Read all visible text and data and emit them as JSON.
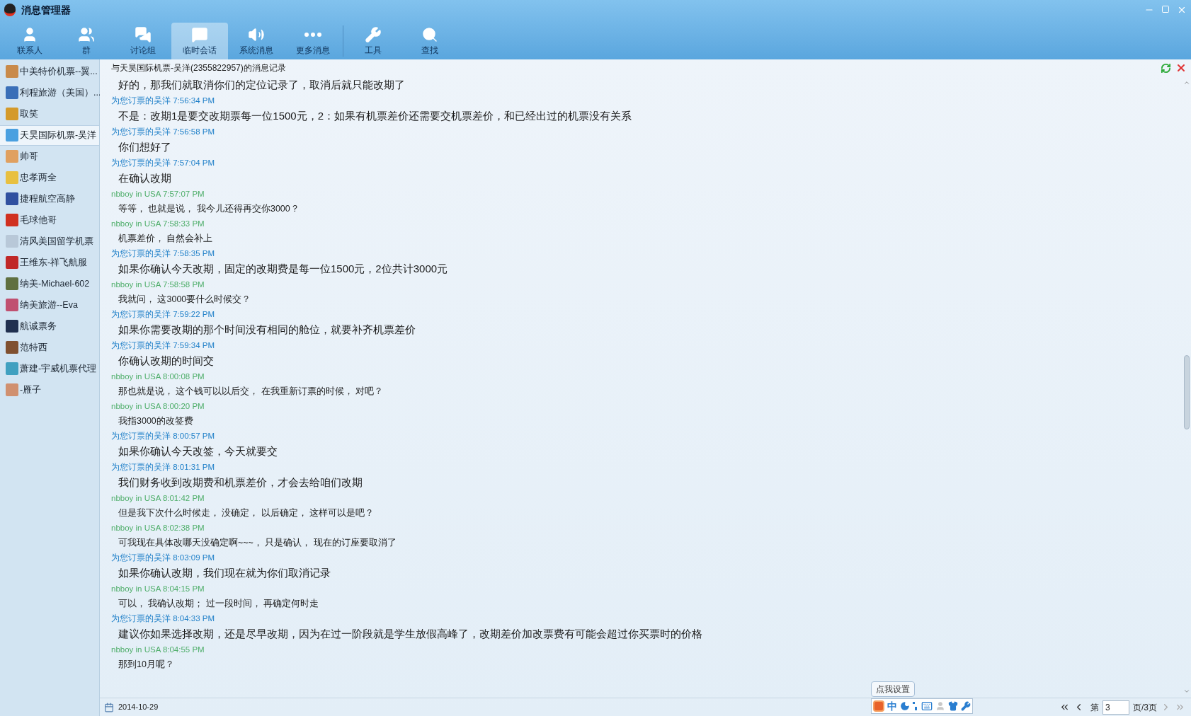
{
  "window": {
    "title": "消息管理器"
  },
  "tabs": [
    {
      "label": "联系人",
      "kind": "user",
      "selected": false
    },
    {
      "label": "群",
      "kind": "group",
      "selected": false
    },
    {
      "label": "讨论组",
      "kind": "discuss",
      "selected": false
    },
    {
      "label": "临时会话",
      "kind": "temp",
      "selected": true
    },
    {
      "label": "系统消息",
      "kind": "speaker",
      "selected": false
    },
    {
      "label": "更多消息",
      "kind": "more",
      "selected": false
    },
    {
      "label": "工具",
      "kind": "wrench",
      "selected": false
    },
    {
      "label": "查找",
      "kind": "search",
      "selected": false
    }
  ],
  "contacts": [
    {
      "name": "中美特价机票--翼...",
      "selected": false
    },
    {
      "name": "利程旅游（美国）...",
      "selected": false
    },
    {
      "name": "取笑",
      "selected": false
    },
    {
      "name": "天昊国际机票-吴洋",
      "selected": true
    },
    {
      "name": "帅哥",
      "selected": false
    },
    {
      "name": "忠孝两全",
      "selected": false
    },
    {
      "name": "捷程航空高静",
      "selected": false
    },
    {
      "name": "毛球他哥",
      "selected": false
    },
    {
      "name": "清风美国留学机票",
      "selected": false
    },
    {
      "name": "王维东-祥飞航服",
      "selected": false
    },
    {
      "name": "纳美-Michael-602",
      "selected": false
    },
    {
      "name": "纳美旅游--Eva",
      "selected": false
    },
    {
      "name": "航诚票务",
      "selected": false
    },
    {
      "name": "范特西",
      "selected": false
    },
    {
      "name": "萧建-宇威机票代理",
      "selected": false
    },
    {
      "name": "-雁子",
      "selected": false
    }
  ],
  "conversation": {
    "title": "与天昊国际机票-吴洋(2355822957)的消息记录",
    "messages": [
      {
        "kind": "agent",
        "text": "好的，那我们就取消你们的定位记录了，取消后就只能改期了"
      },
      {
        "kind": "agent",
        "header": "为您订票的吴洋 7:56:34 PM",
        "text": "不是：改期1是要交改期票每一位1500元，2：如果有机票差价还需要交机票差价，和已经出过的机票没有关系"
      },
      {
        "kind": "agent",
        "header": "为您订票的吴洋 7:56:58 PM",
        "text": "你们想好了"
      },
      {
        "kind": "agent",
        "header": "为您订票的吴洋 7:57:04 PM",
        "text": "在确认改期"
      },
      {
        "kind": "user",
        "header": "nbboy in USA 7:57:07 PM",
        "text": "等等， 也就是说， 我今儿还得再交你3000？"
      },
      {
        "kind": "user",
        "header": "nbboy in USA 7:58:33 PM",
        "text": "机票差价， 自然会补上"
      },
      {
        "kind": "agent",
        "header": "为您订票的吴洋 7:58:35 PM",
        "text": "如果你确认今天改期，固定的改期费是每一位1500元，2位共计3000元"
      },
      {
        "kind": "user",
        "header": "nbboy in USA 7:58:58 PM",
        "text": "我就问， 这3000要什么时候交？"
      },
      {
        "kind": "agent",
        "header": "为您订票的吴洋 7:59:22 PM",
        "text": "如果你需要改期的那个时间没有相同的舱位，就要补齐机票差价"
      },
      {
        "kind": "agent",
        "header": "为您订票的吴洋 7:59:34 PM",
        "text": "你确认改期的时间交"
      },
      {
        "kind": "user",
        "header": "nbboy in USA 8:00:08 PM",
        "text": "那也就是说， 这个钱可以以后交， 在我重新订票的时候， 对吧？"
      },
      {
        "kind": "user",
        "header": "nbboy in USA 8:00:20 PM",
        "text": "我指3000的改签费"
      },
      {
        "kind": "agent",
        "header": "为您订票的吴洋 8:00:57 PM",
        "text": "如果你确认今天改签，今天就要交"
      },
      {
        "kind": "agent",
        "header": "为您订票的吴洋 8:01:31 PM",
        "text": "我们财务收到改期费和机票差价，才会去给咱们改期"
      },
      {
        "kind": "user",
        "header": "nbboy in USA 8:01:42 PM",
        "text": "但是我下次什么时候走， 没确定， 以后确定， 这样可以是吧？"
      },
      {
        "kind": "user",
        "header": "nbboy in USA 8:02:38 PM",
        "text": "可我现在具体改哪天没确定啊~~~， 只是确认， 现在的订座要取消了"
      },
      {
        "kind": "agent",
        "header": "为您订票的吴洋 8:03:09 PM",
        "text": "如果你确认改期，我们现在就为你们取消记录"
      },
      {
        "kind": "user",
        "header": "nbboy in USA 8:04:15 PM",
        "text": "可以， 我确认改期； 过一段时间， 再确定何时走"
      },
      {
        "kind": "agent",
        "header": "为您订票的吴洋 8:04:33 PM",
        "text": "建议你如果选择改期，还是尽早改期，因为在过一阶段就是学生放假高峰了，改期差价加改票费有可能会超过你买票时的价格"
      },
      {
        "kind": "user",
        "header": "nbboy in USA 8:04:55 PM",
        "text": "那到10月呢？"
      }
    ]
  },
  "footer": {
    "date": "2014-10-29",
    "ime": {
      "tooltip": "点我设置",
      "mode": "中"
    },
    "pagination": {
      "prefix": "第",
      "page": "3",
      "suffix": "页/3页"
    }
  }
}
